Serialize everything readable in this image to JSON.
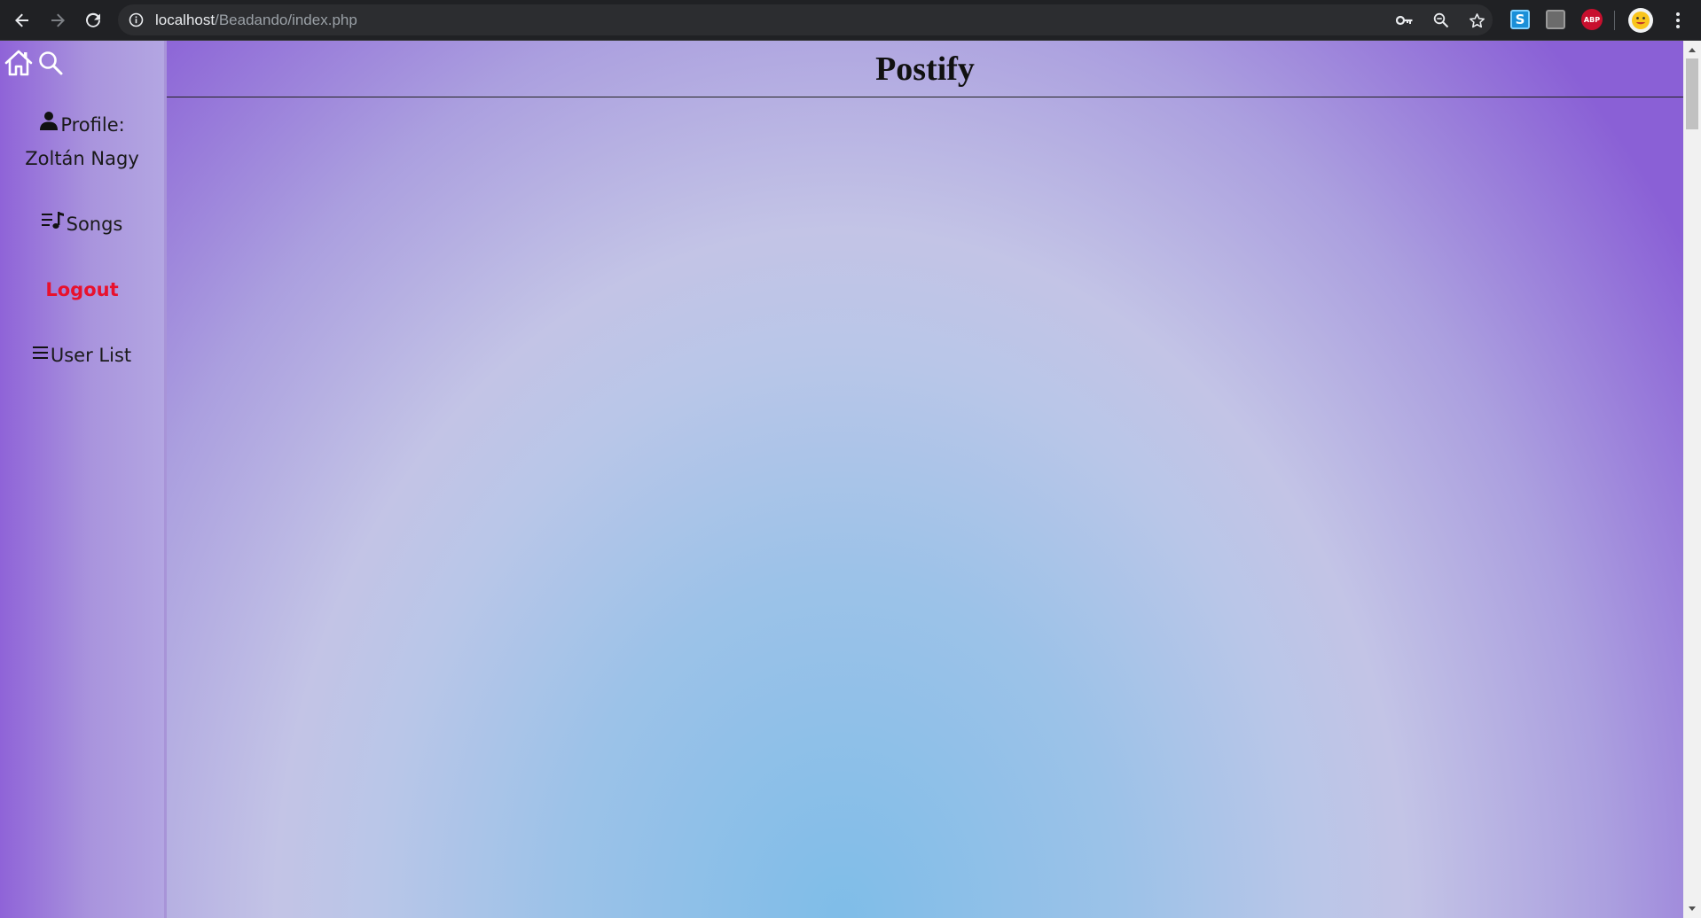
{
  "browser": {
    "url_host": "localhost",
    "url_path": "/Beadando/index.php",
    "icons": {
      "back": "back-arrow-icon",
      "forward": "forward-arrow-icon",
      "reload": "reload-icon",
      "site_info": "info-icon",
      "password": "key-icon",
      "zoom": "zoom-icon",
      "bookmark": "star-icon"
    },
    "extensions": [
      {
        "name": "skype-extension-icon",
        "label": "S",
        "color": "#1a8fd8"
      },
      {
        "name": "gray-extension-icon",
        "label": "",
        "color": "#7a7a7a"
      },
      {
        "name": "adblock-plus-icon",
        "label": "ABP",
        "color": "#c8102e"
      }
    ]
  },
  "sidebar": {
    "icons": [
      "home-icon",
      "search-icon"
    ],
    "profile_label": "Profile:",
    "profile_name": "Zoltán Nagy",
    "songs_label": "Songs",
    "logout_label": "Logout",
    "userlist_label": "User List",
    "logout_color": "#e8112d"
  },
  "header": {
    "title": "Postify"
  },
  "theme": {
    "accent_purple": "#8a60d6",
    "center_blue": "#7fbde8"
  }
}
